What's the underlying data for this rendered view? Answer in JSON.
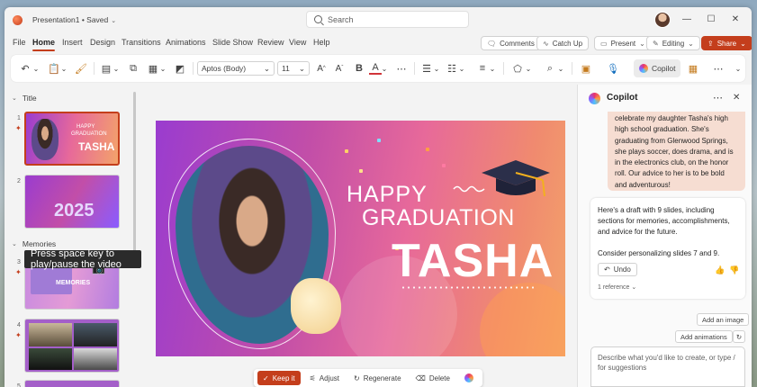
{
  "titlebar": {
    "doc_title": "Presentation1 • Saved",
    "search_placeholder": "Search"
  },
  "menu": {
    "items": [
      "File",
      "Home",
      "Insert",
      "Design",
      "Transitions",
      "Animations",
      "Slide Show",
      "Review",
      "View",
      "Help"
    ],
    "active": "Home",
    "comments": "Comments",
    "catch_up": "Catch Up",
    "present": "Present",
    "editing": "Editing",
    "share": "Share"
  },
  "ribbon": {
    "font_name": "Aptos (Body)",
    "font_size": "11",
    "copilot": "Copilot"
  },
  "thumbnails": {
    "section_title": "Title",
    "section_memories": "Memories",
    "slide_numbers": [
      "1",
      "2",
      "3",
      "4",
      "5"
    ],
    "thumb1_happy": "HAPPY",
    "thumb1_grad": "GRADUATION",
    "thumb1_name": "TASHA",
    "thumb2_year": "2025",
    "thumb3_label": "MEMORIES",
    "tooltip": "Press space key to play/pause the video"
  },
  "slide": {
    "happy": "HAPPY",
    "graduation": "GRADUATION",
    "name": "TASHA"
  },
  "actions": {
    "keep": "Keep it",
    "adjust": "Adjust",
    "regenerate": "Regenerate",
    "delete": "Delete"
  },
  "copilot": {
    "title": "Copilot",
    "user_message": "celebrate my daughter Tasha's high high school graduation. She's graduating from Glenwood Springs, she plays soccer, does drama, and is in the electronics club, on the honor roll. Our advice to her is to be bold and adventurous!",
    "bot_message_1": "Here's a draft with 9 slides, including sections for memories, accomplishments, and advice for the future.",
    "bot_message_2": "Consider personalizing slides 7 and 9.",
    "undo": "Undo",
    "reference": "1 reference",
    "add_image": "Add an image",
    "add_animations": "Add animations",
    "composer_placeholder": "Describe what you'd like to create, or type / for suggestions"
  },
  "colors": {
    "accent": "#c43e1c",
    "user_bubble": "#f6ddd2"
  }
}
